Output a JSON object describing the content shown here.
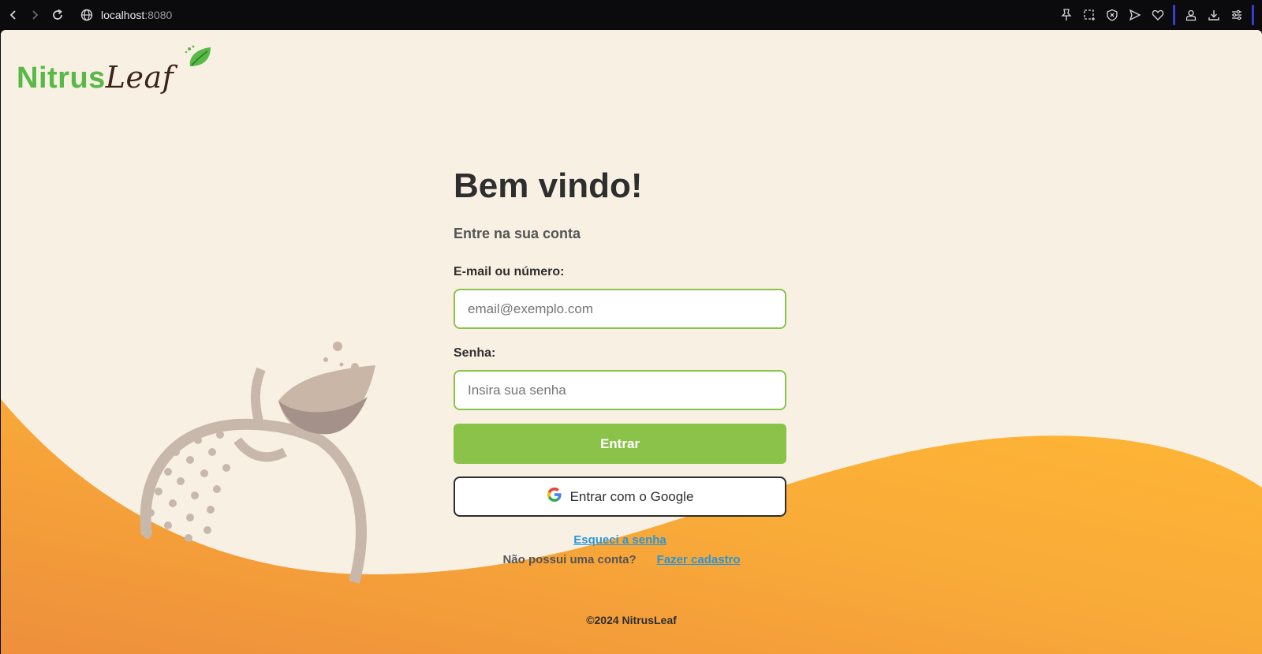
{
  "browser": {
    "url_host": "localhost",
    "url_port": ":8080",
    "icons": [
      "back-icon",
      "forward-icon",
      "reload-icon",
      "globe-icon",
      "pin-icon",
      "screenshot-icon",
      "shield-icon",
      "send-icon",
      "heart-icon",
      "profile-icon",
      "download-icon",
      "settings-icon"
    ]
  },
  "colors": {
    "accent": "#8bc34a",
    "background": "#f9f0e4",
    "wave": "#f7a33a",
    "link": "#2b95d6"
  },
  "brand": {
    "part1": "Nitrus",
    "part2": "Leaf"
  },
  "login": {
    "title": "Bem vindo!",
    "subtitle": "Entre na sua conta",
    "email_label": "E-mail ou número:",
    "email_placeholder": "email@exemplo.com",
    "password_label": "Senha:",
    "password_placeholder": "Insira sua senha",
    "submit_label": "Entrar",
    "google_label": "Entrar com o Google",
    "forgot_label": "Esqueci a senha",
    "no_account_text": "Não possui uma conta?",
    "signup_label": "Fazer cadastro"
  },
  "footer": {
    "text": "©2024 NitrusLeaf"
  }
}
